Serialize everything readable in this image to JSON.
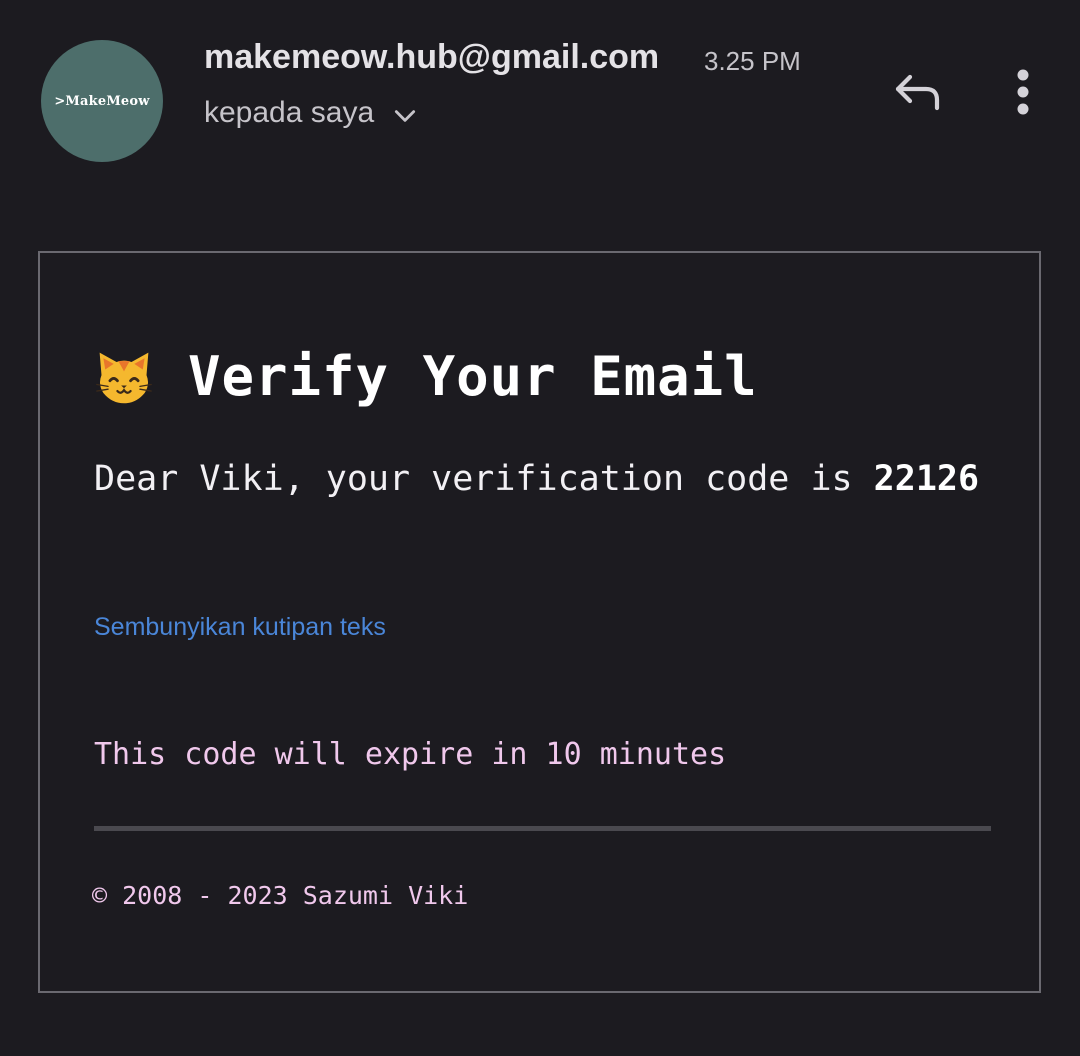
{
  "header": {
    "avatar_text": ">MakeMeow",
    "sender": "makemeow.hub@gmail.com",
    "time": "3.25 PM",
    "recipient": "kepada saya",
    "icons": [
      "chevron-down-icon",
      "reply-icon",
      "more-vert-icon"
    ]
  },
  "email": {
    "heading_icon": "cat-face-icon",
    "heading": "Verify Your Email",
    "code_prefix": "Dear Viki, your verification code is",
    "code": "22126",
    "hide_quoted_link": "Sembunyikan kutipan teks",
    "expire_text": "This code will expire in 10 minutes",
    "footer": "© 2008 - 2023 Sazumi Viki"
  },
  "colors": {
    "background": "#1c1b20",
    "avatar_bg": "#4d6e6b",
    "link": "#4a86d8",
    "pink_text": "#f0c8ec",
    "card_border": "#6a6970"
  }
}
